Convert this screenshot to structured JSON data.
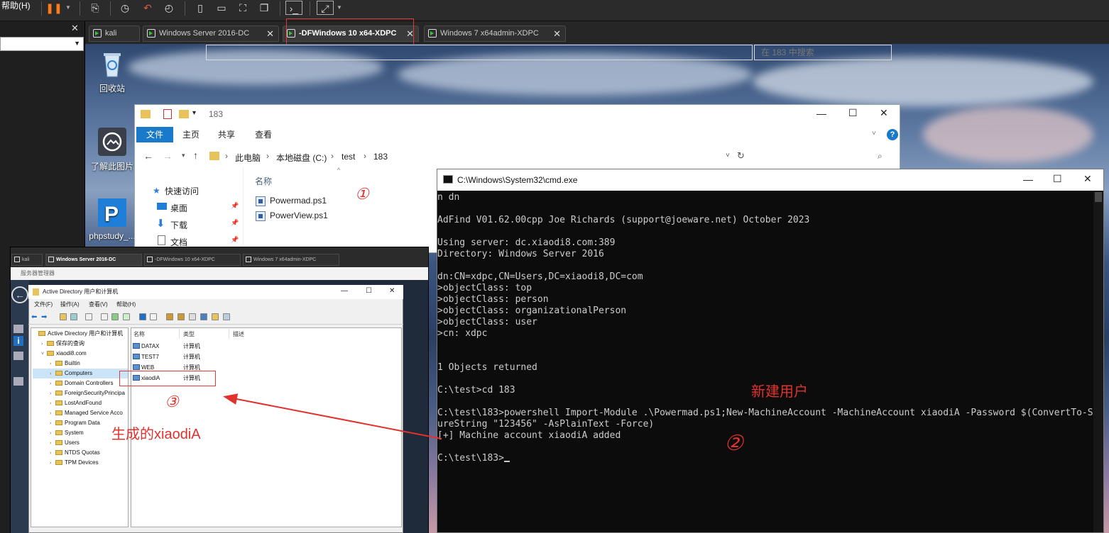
{
  "host": {
    "menu_help": "帮助(H)",
    "tabs": [
      {
        "label": "kali"
      },
      {
        "label": "Windows Server 2016-DC"
      },
      {
        "label": "-DFWindows 10 x64-XDPC"
      },
      {
        "label": "Windows 7 x64admin-XDPC"
      }
    ],
    "accent_red": "#e03a3a"
  },
  "desktop": {
    "icons": [
      {
        "label": "回收站",
        "icon": "recycle-bin-icon"
      },
      {
        "label": "了解此图片",
        "icon": "camera-icon"
      },
      {
        "label": "phpstudy_...",
        "icon": "phpstudy-icon"
      }
    ]
  },
  "explorer": {
    "title": "183",
    "ribbon_tabs": [
      "文件",
      "主页",
      "共享",
      "查看"
    ],
    "breadcrumb": [
      "此电脑",
      "本地磁盘 (C:)",
      "test",
      "183"
    ],
    "search_placeholder": "在 183 中搜索",
    "nav": [
      "快速访问",
      "桌面",
      "下载",
      "文档"
    ],
    "column_name": "名称",
    "files": [
      "Powermad.ps1",
      "PowerView.ps1"
    ]
  },
  "inner_vm": {
    "tabs": [
      "kali",
      "Windows Server 2016-DC",
      "-DFWindows 10 x64-XDPC",
      "Windows 7 x64admin-XDPC"
    ],
    "server_manager": "服务器管理器"
  },
  "aduc": {
    "title": "Active Directory 用户和计算机",
    "menu": [
      "文件(F)",
      "操作(A)",
      "查看(V)",
      "帮助(H)"
    ],
    "tree": [
      {
        "label": "Active Directory 用户和计算机",
        "depth": 0
      },
      {
        "label": "保存的查询",
        "depth": 1
      },
      {
        "label": "xiaodi8.com",
        "depth": 1
      },
      {
        "label": "Builtin",
        "depth": 2
      },
      {
        "label": "Computers",
        "depth": 2,
        "selected": true
      },
      {
        "label": "Domain Controllers",
        "depth": 2
      },
      {
        "label": "ForeignSecurityPrincipa",
        "depth": 2
      },
      {
        "label": "LostAndFound",
        "depth": 2
      },
      {
        "label": "Managed Service Acco",
        "depth": 2
      },
      {
        "label": "Program Data",
        "depth": 2
      },
      {
        "label": "System",
        "depth": 2
      },
      {
        "label": "Users",
        "depth": 2
      },
      {
        "label": "NTDS Quotas",
        "depth": 2
      },
      {
        "label": "TPM Devices",
        "depth": 2
      }
    ],
    "columns": [
      "名称",
      "类型",
      "描述"
    ],
    "rows": [
      {
        "name": "DATAX",
        "type": "计算机"
      },
      {
        "name": "TEST7",
        "type": "计算机"
      },
      {
        "name": "WEB",
        "type": "计算机"
      },
      {
        "name": "xiaodiA",
        "type": "计算机"
      }
    ]
  },
  "cmd": {
    "title": "C:\\Windows\\System32\\cmd.exe",
    "lines": [
      "n dn",
      "",
      "AdFind V01.62.00cpp Joe Richards (support@joeware.net) October 2023",
      "",
      "Using server: dc.xiaodi8.com:389",
      "Directory: Windows Server 2016",
      "",
      "dn:CN=xdpc,CN=Users,DC=xiaodi8,DC=com",
      ">objectClass: top",
      ">objectClass: person",
      ">objectClass: organizationalPerson",
      ">objectClass: user",
      ">cn: xdpc",
      "",
      "",
      "1 Objects returned",
      "",
      "C:\\test>cd 183",
      "",
      "C:\\test\\183>powershell Import-Module .\\Powermad.ps1;New-MachineAccount -MachineAccount xiaodiA -Password $(ConvertTo-Sec",
      "ureString \"123456\" -AsPlainText -Force)",
      "[+] Machine account xiaodiA added",
      "",
      "C:\\test\\183>"
    ]
  },
  "annotations": {
    "new_user": "新建用户",
    "generated": "生成的xiaodiA",
    "mark1": "①",
    "mark2": "②",
    "mark3": "③"
  }
}
